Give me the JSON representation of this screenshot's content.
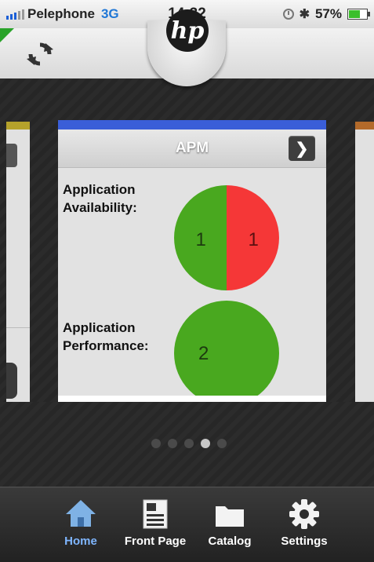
{
  "status_bar": {
    "carrier": "Pelephone",
    "network": "3G",
    "time": "14:32",
    "battery": "57%",
    "battery_level": 0.57,
    "icons": [
      "signal-icon",
      "clock-icon",
      "bluetooth-icon",
      "battery-icon"
    ]
  },
  "header": {
    "logo_text": "hp",
    "refresh_icon": "refresh-icon"
  },
  "card": {
    "title": "APM",
    "accent_color": "#3a5ed8",
    "metrics": [
      {
        "label_line1": "Application",
        "label_line2": "Availability:",
        "values": [
          1,
          1
        ],
        "colors": [
          "#49a81f",
          "#f53737"
        ]
      },
      {
        "label_line1": "Application",
        "label_line2": "Performance:",
        "values": [
          2
        ],
        "colors": [
          "#49a81f"
        ]
      }
    ]
  },
  "pager": {
    "count": 5,
    "active_index": 3
  },
  "tabs": [
    {
      "label": "Home",
      "icon": "home-icon",
      "active": true
    },
    {
      "label": "Front Page",
      "icon": "front-page-icon",
      "active": false
    },
    {
      "label": "Catalog",
      "icon": "folder-icon",
      "active": false
    },
    {
      "label": "Settings",
      "icon": "gear-icon",
      "active": false
    }
  ]
}
